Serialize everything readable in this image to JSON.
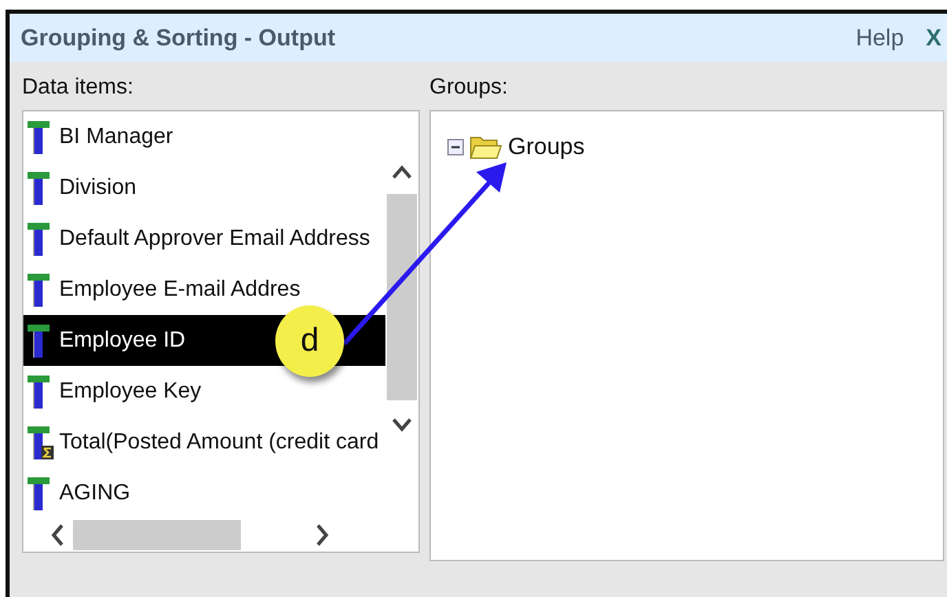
{
  "window": {
    "title": "Grouping & Sorting - Output",
    "help": "Help",
    "close": "X"
  },
  "data_items": {
    "label": "Data items:",
    "items": [
      {
        "label": "BI Manager",
        "kind": "attribute",
        "selected": false
      },
      {
        "label": "Division",
        "kind": "attribute",
        "selected": false
      },
      {
        "label": "Default Approver Email Address",
        "kind": "attribute",
        "selected": false
      },
      {
        "label": "Employee E-mail Addres",
        "kind": "attribute",
        "selected": false
      },
      {
        "label": "Employee ID",
        "kind": "attribute",
        "selected": true
      },
      {
        "label": "Employee Key",
        "kind": "attribute",
        "selected": false
      },
      {
        "label": "Total(Posted Amount (credit card",
        "kind": "measure",
        "selected": false
      },
      {
        "label": "AGING",
        "kind": "attribute",
        "selected": false
      }
    ]
  },
  "groups": {
    "label": "Groups:",
    "tree": [
      {
        "label": "Groups",
        "expanded": true
      }
    ]
  },
  "callout": {
    "label": "d"
  }
}
